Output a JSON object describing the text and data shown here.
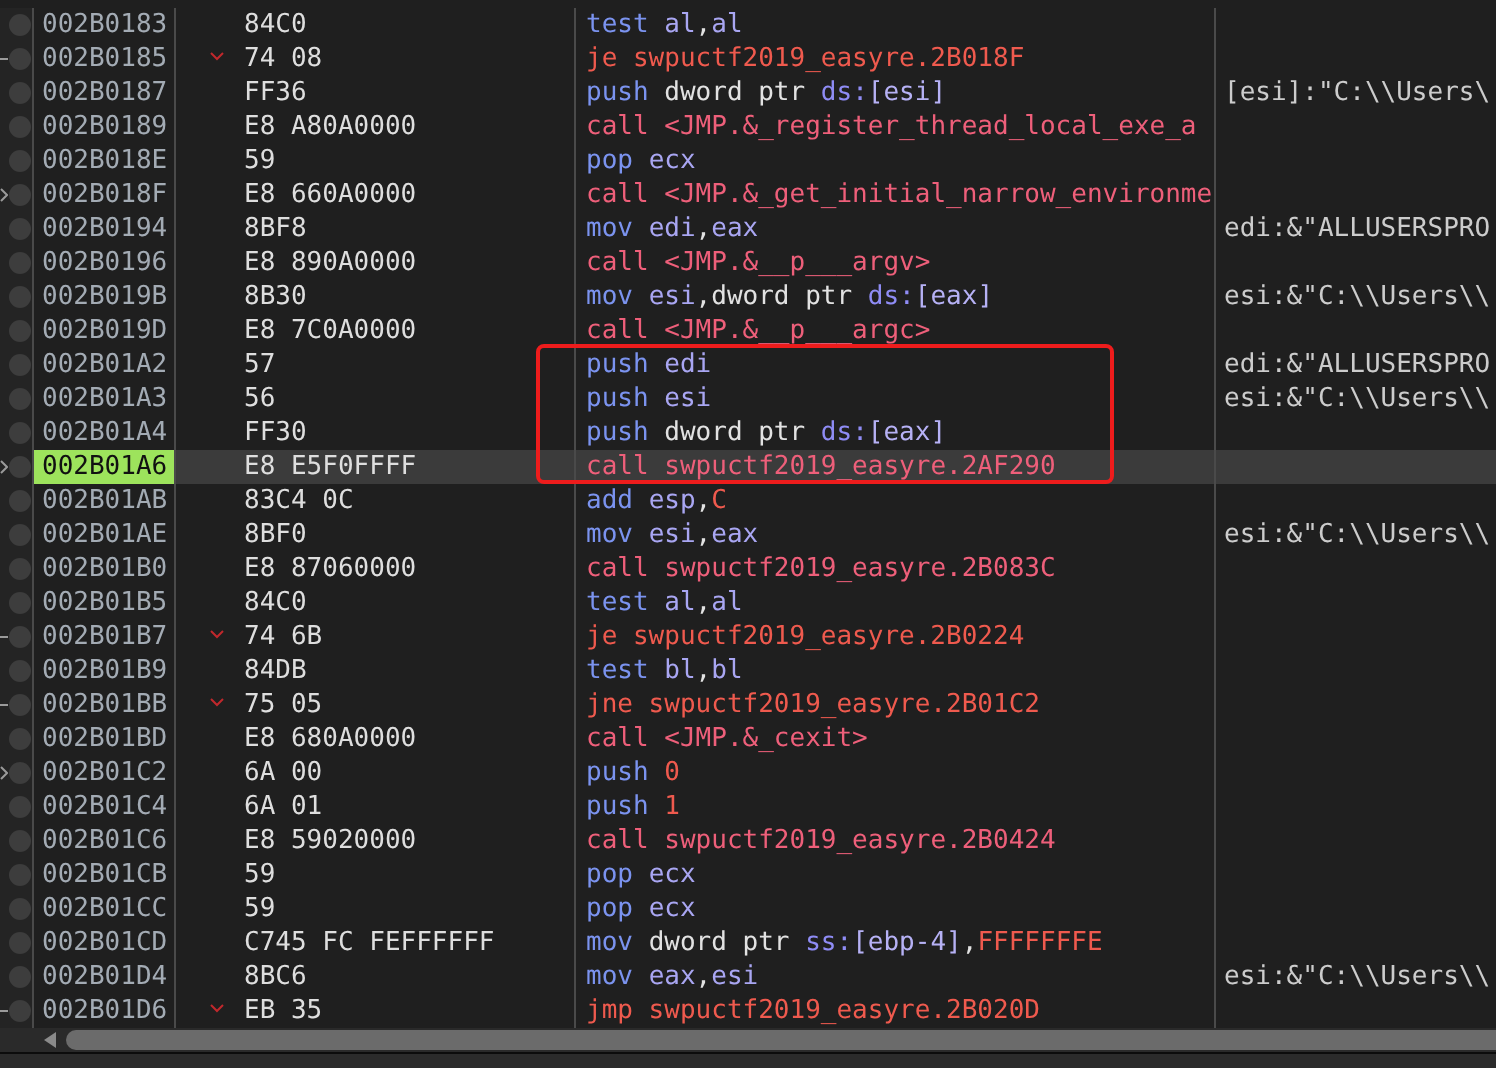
{
  "rows": [
    {
      "address": "002B0183",
      "bytes": "84C0",
      "jump": false,
      "jump_target": false,
      "selected": false,
      "instruction": [
        {
          "text": "test ",
          "kind": "op"
        },
        {
          "text": "al",
          "kind": "reg"
        },
        {
          "text": ",",
          "kind": "plain"
        },
        {
          "text": "al",
          "kind": "reg"
        }
      ]
    },
    {
      "address": "002B0185",
      "bytes": "74 08",
      "jump": true,
      "jump_target": false,
      "selected": false,
      "instruction": [
        {
          "text": "je swpuctf2019_easyre.2B018F",
          "kind": "jump"
        }
      ]
    },
    {
      "address": "002B0187",
      "bytes": "FF36",
      "jump": false,
      "jump_target": false,
      "selected": false,
      "instruction": [
        {
          "text": "push ",
          "kind": "op"
        },
        {
          "text": "dword ptr ",
          "kind": "size"
        },
        {
          "text": "ds:",
          "kind": "seg"
        },
        {
          "text": "[esi]",
          "kind": "mem"
        }
      ],
      "comment": "[esi]:\"C:\\\\Users\\"
    },
    {
      "address": "002B0189",
      "bytes": "E8 A80A0000",
      "jump": false,
      "jump_target": false,
      "selected": false,
      "instruction": [
        {
          "text": "call ",
          "kind": "call"
        },
        {
          "text": "<JMP.&_register_thread_local_exe_a",
          "kind": "target"
        }
      ]
    },
    {
      "address": "002B018E",
      "bytes": "59",
      "jump": false,
      "jump_target": false,
      "selected": false,
      "instruction": [
        {
          "text": "pop ",
          "kind": "op"
        },
        {
          "text": "ecx",
          "kind": "reg"
        }
      ]
    },
    {
      "address": "002B018F",
      "bytes": "E8 660A0000",
      "jump": false,
      "jump_target": true,
      "selected": false,
      "instruction": [
        {
          "text": "call ",
          "kind": "call"
        },
        {
          "text": "<JMP.&_get_initial_narrow_environme",
          "kind": "target"
        }
      ]
    },
    {
      "address": "002B0194",
      "bytes": "8BF8",
      "jump": false,
      "jump_target": false,
      "selected": false,
      "instruction": [
        {
          "text": "mov ",
          "kind": "op"
        },
        {
          "text": "edi",
          "kind": "reg"
        },
        {
          "text": ",",
          "kind": "plain"
        },
        {
          "text": "eax",
          "kind": "reg"
        }
      ],
      "comment": "edi:&\"ALLUSERSPRO"
    },
    {
      "address": "002B0196",
      "bytes": "E8 890A0000",
      "jump": false,
      "jump_target": false,
      "selected": false,
      "instruction": [
        {
          "text": "call ",
          "kind": "call"
        },
        {
          "text": "<JMP.&__p___argv>",
          "kind": "target"
        }
      ]
    },
    {
      "address": "002B019B",
      "bytes": "8B30",
      "jump": false,
      "jump_target": false,
      "selected": false,
      "instruction": [
        {
          "text": "mov ",
          "kind": "op"
        },
        {
          "text": "esi",
          "kind": "reg"
        },
        {
          "text": ",",
          "kind": "plain"
        },
        {
          "text": "dword ptr ",
          "kind": "size"
        },
        {
          "text": "ds:",
          "kind": "seg"
        },
        {
          "text": "[eax]",
          "kind": "mem"
        }
      ],
      "comment": "esi:&\"C:\\\\Users\\\\"
    },
    {
      "address": "002B019D",
      "bytes": "E8 7C0A0000",
      "jump": false,
      "jump_target": false,
      "selected": false,
      "instruction": [
        {
          "text": "call ",
          "kind": "call"
        },
        {
          "text": "<JMP.&__p___argc>",
          "kind": "target"
        }
      ]
    },
    {
      "address": "002B01A2",
      "bytes": "57",
      "jump": false,
      "jump_target": false,
      "selected": false,
      "instruction": [
        {
          "text": "push ",
          "kind": "op"
        },
        {
          "text": "edi",
          "kind": "reg"
        }
      ],
      "comment": "edi:&\"ALLUSERSPRO"
    },
    {
      "address": "002B01A3",
      "bytes": "56",
      "jump": false,
      "jump_target": false,
      "selected": false,
      "instruction": [
        {
          "text": "push ",
          "kind": "op"
        },
        {
          "text": "esi",
          "kind": "reg"
        }
      ],
      "comment": "esi:&\"C:\\\\Users\\\\"
    },
    {
      "address": "002B01A4",
      "bytes": "FF30",
      "jump": false,
      "jump_target": false,
      "selected": false,
      "instruction": [
        {
          "text": "push ",
          "kind": "op"
        },
        {
          "text": "dword ptr ",
          "kind": "size"
        },
        {
          "text": "ds:",
          "kind": "seg"
        },
        {
          "text": "[eax]",
          "kind": "mem"
        }
      ]
    },
    {
      "address": "002B01A6",
      "bytes": "E8 E5F0FFFF",
      "jump": false,
      "jump_target": true,
      "selected": true,
      "instruction": [
        {
          "text": "call ",
          "kind": "call"
        },
        {
          "text": "swpuctf2019_easyre.2AF290",
          "kind": "target"
        }
      ]
    },
    {
      "address": "002B01AB",
      "bytes": "83C4 0C",
      "jump": false,
      "jump_target": false,
      "selected": false,
      "instruction": [
        {
          "text": "add ",
          "kind": "op"
        },
        {
          "text": "esp",
          "kind": "reg"
        },
        {
          "text": ",",
          "kind": "plain"
        },
        {
          "text": "C",
          "kind": "num"
        }
      ]
    },
    {
      "address": "002B01AE",
      "bytes": "8BF0",
      "jump": false,
      "jump_target": false,
      "selected": false,
      "instruction": [
        {
          "text": "mov ",
          "kind": "op"
        },
        {
          "text": "esi",
          "kind": "reg"
        },
        {
          "text": ",",
          "kind": "plain"
        },
        {
          "text": "eax",
          "kind": "reg"
        }
      ],
      "comment": "esi:&\"C:\\\\Users\\\\"
    },
    {
      "address": "002B01B0",
      "bytes": "E8 87060000",
      "jump": false,
      "jump_target": false,
      "selected": false,
      "instruction": [
        {
          "text": "call ",
          "kind": "call"
        },
        {
          "text": "swpuctf2019_easyre.2B083C",
          "kind": "target"
        }
      ]
    },
    {
      "address": "002B01B5",
      "bytes": "84C0",
      "jump": false,
      "jump_target": false,
      "selected": false,
      "instruction": [
        {
          "text": "test ",
          "kind": "op"
        },
        {
          "text": "al",
          "kind": "reg"
        },
        {
          "text": ",",
          "kind": "plain"
        },
        {
          "text": "al",
          "kind": "reg"
        }
      ]
    },
    {
      "address": "002B01B7",
      "bytes": "74 6B",
      "jump": true,
      "jump_target": false,
      "selected": false,
      "instruction": [
        {
          "text": "je swpuctf2019_easyre.2B0224",
          "kind": "jump"
        }
      ]
    },
    {
      "address": "002B01B9",
      "bytes": "84DB",
      "jump": false,
      "jump_target": false,
      "selected": false,
      "instruction": [
        {
          "text": "test ",
          "kind": "op"
        },
        {
          "text": "bl",
          "kind": "reg"
        },
        {
          "text": ",",
          "kind": "plain"
        },
        {
          "text": "bl",
          "kind": "reg"
        }
      ]
    },
    {
      "address": "002B01BB",
      "bytes": "75 05",
      "jump": true,
      "jump_target": false,
      "selected": false,
      "instruction": [
        {
          "text": "jne swpuctf2019_easyre.2B01C2",
          "kind": "jump"
        }
      ]
    },
    {
      "address": "002B01BD",
      "bytes": "E8 680A0000",
      "jump": false,
      "jump_target": false,
      "selected": false,
      "instruction": [
        {
          "text": "call ",
          "kind": "call"
        },
        {
          "text": "<JMP.&_cexit>",
          "kind": "target"
        }
      ]
    },
    {
      "address": "002B01C2",
      "bytes": "6A 00",
      "jump": false,
      "jump_target": true,
      "selected": false,
      "instruction": [
        {
          "text": "push ",
          "kind": "op"
        },
        {
          "text": "0",
          "kind": "num"
        }
      ]
    },
    {
      "address": "002B01C4",
      "bytes": "6A 01",
      "jump": false,
      "jump_target": false,
      "selected": false,
      "instruction": [
        {
          "text": "push ",
          "kind": "op"
        },
        {
          "text": "1",
          "kind": "num"
        }
      ]
    },
    {
      "address": "002B01C6",
      "bytes": "E8 59020000",
      "jump": false,
      "jump_target": false,
      "selected": false,
      "instruction": [
        {
          "text": "call ",
          "kind": "call"
        },
        {
          "text": "swpuctf2019_easyre.2B0424",
          "kind": "target"
        }
      ]
    },
    {
      "address": "002B01CB",
      "bytes": "59",
      "jump": false,
      "jump_target": false,
      "selected": false,
      "instruction": [
        {
          "text": "pop ",
          "kind": "op"
        },
        {
          "text": "ecx",
          "kind": "reg"
        }
      ]
    },
    {
      "address": "002B01CC",
      "bytes": "59",
      "jump": false,
      "jump_target": false,
      "selected": false,
      "instruction": [
        {
          "text": "pop ",
          "kind": "op"
        },
        {
          "text": "ecx",
          "kind": "reg"
        }
      ]
    },
    {
      "address": "002B01CD",
      "bytes": "C745 FC FEFFFFFF",
      "jump": false,
      "jump_target": false,
      "selected": false,
      "instruction": [
        {
          "text": "mov ",
          "kind": "op"
        },
        {
          "text": "dword ptr ",
          "kind": "size"
        },
        {
          "text": "ss:",
          "kind": "seg"
        },
        {
          "text": "[ebp-4]",
          "kind": "mem"
        },
        {
          "text": ",",
          "kind": "plain"
        },
        {
          "text": "FFFFFFFE",
          "kind": "num"
        }
      ]
    },
    {
      "address": "002B01D4",
      "bytes": "8BC6",
      "jump": false,
      "jump_target": false,
      "selected": false,
      "instruction": [
        {
          "text": "mov ",
          "kind": "op"
        },
        {
          "text": "eax",
          "kind": "reg"
        },
        {
          "text": ",",
          "kind": "plain"
        },
        {
          "text": "esi",
          "kind": "reg"
        }
      ],
      "comment": "esi:&\"C:\\\\Users\\\\"
    },
    {
      "address": "002B01D6",
      "bytes": "EB 35",
      "jump": true,
      "jump_target": false,
      "selected": false,
      "instruction": [
        {
          "text": "jmp swpuctf2019_easyre.2B020D",
          "kind": "jump"
        }
      ]
    }
  ]
}
